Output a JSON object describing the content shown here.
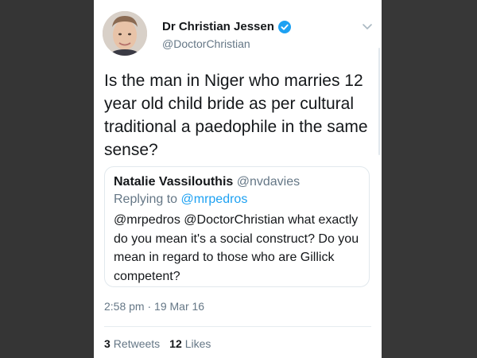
{
  "author": {
    "display_name": "Dr Christian Jessen",
    "handle": "@DoctorChristian",
    "verified": true
  },
  "tweet": {
    "text": "Is the man in Niger who marries 12 year old child bride as per cultural traditional a paedophile in the same sense?",
    "timestamp": "2:58 pm · 19 Mar 16"
  },
  "quoted_tweet": {
    "display_name": "Natalie Vassilouthis",
    "handle": "@nvdavies",
    "replying_prefix": "Replying to",
    "replying_to": "@mrpedros",
    "text": "@mrpedros @DoctorChristian what exactly do you mean it's a social construct? Do you mean in regard to those who are Gillick competent?"
  },
  "stats": {
    "retweets_count": "3",
    "retweets_label": "Retweets",
    "likes_count": "12",
    "likes_label": "Likes"
  },
  "icons": {
    "verified": "verified-badge-icon",
    "menu": "chevron-down-icon"
  },
  "colors": {
    "verified_blue": "#1da1f2",
    "secondary_text": "#657786",
    "primary_text": "#14171a",
    "border": "#e1e8ed"
  }
}
